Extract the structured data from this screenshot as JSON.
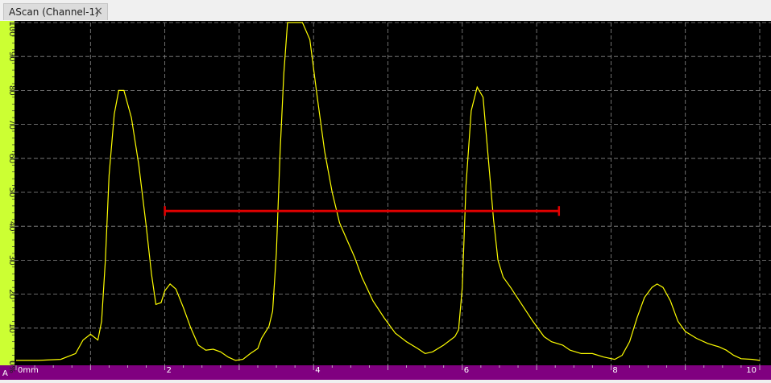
{
  "tab": {
    "title": "AScan (Channel-1)",
    "close_glyph": "×"
  },
  "colors": {
    "background": "#000000",
    "grid": "#8a8a8a",
    "signal": "#ffff00",
    "gate": "#e00000",
    "amplitude_axis": "#ccff33",
    "depth_axis": "#800080",
    "axis_text": "#ffffff"
  },
  "corner_label": "A",
  "chart_data": {
    "type": "line",
    "xlim": [
      0,
      10
    ],
    "ylim": [
      0,
      100
    ],
    "x_unit": "mm",
    "y_unit": "%",
    "x_tick_labels": [
      "0mm",
      "2",
      "4",
      "6",
      "8",
      "10"
    ],
    "y_tick_labels": [
      "0%",
      "10",
      "20",
      "30",
      "40",
      "50",
      "60",
      "70",
      "80",
      "90",
      "100"
    ],
    "grid": true,
    "gate": {
      "start": 2.0,
      "end": 7.3,
      "level": 44.5
    },
    "series": [
      {
        "points": [
          [
            0,
            0.5
          ],
          [
            0.3,
            0.5
          ],
          [
            0.6,
            0.8
          ],
          [
            0.8,
            2.5
          ],
          [
            0.9,
            6.5
          ],
          [
            1.0,
            8.2
          ],
          [
            1.1,
            6.5
          ],
          [
            1.15,
            12
          ],
          [
            1.2,
            30
          ],
          [
            1.25,
            55
          ],
          [
            1.32,
            73
          ],
          [
            1.38,
            80
          ],
          [
            1.45,
            80
          ],
          [
            1.55,
            72
          ],
          [
            1.65,
            58
          ],
          [
            1.75,
            40
          ],
          [
            1.82,
            26
          ],
          [
            1.88,
            17
          ],
          [
            1.95,
            17.5
          ],
          [
            2.0,
            21
          ],
          [
            2.07,
            23
          ],
          [
            2.15,
            21.5
          ],
          [
            2.25,
            16
          ],
          [
            2.35,
            10
          ],
          [
            2.45,
            5
          ],
          [
            2.55,
            3.5
          ],
          [
            2.65,
            3.8
          ],
          [
            2.75,
            3
          ],
          [
            2.85,
            1.5
          ],
          [
            2.95,
            0.5
          ],
          [
            3.05,
            0.8
          ],
          [
            3.15,
            2.5
          ],
          [
            3.25,
            4
          ],
          [
            3.3,
            7
          ],
          [
            3.4,
            10.5
          ],
          [
            3.45,
            15
          ],
          [
            3.5,
            32
          ],
          [
            3.55,
            62
          ],
          [
            3.6,
            85
          ],
          [
            3.65,
            100
          ],
          [
            3.7,
            100
          ],
          [
            3.85,
            100
          ],
          [
            3.95,
            95
          ],
          [
            4.05,
            78
          ],
          [
            4.15,
            62
          ],
          [
            4.25,
            50
          ],
          [
            4.35,
            41
          ],
          [
            4.45,
            36
          ],
          [
            4.55,
            31
          ],
          [
            4.65,
            25
          ],
          [
            4.8,
            18
          ],
          [
            4.95,
            13
          ],
          [
            5.1,
            8.5
          ],
          [
            5.25,
            6
          ],
          [
            5.4,
            4
          ],
          [
            5.5,
            2.5
          ],
          [
            5.6,
            3
          ],
          [
            5.75,
            5
          ],
          [
            5.9,
            7.5
          ],
          [
            5.95,
            9.5
          ],
          [
            6.0,
            22
          ],
          [
            6.05,
            52
          ],
          [
            6.12,
            74
          ],
          [
            6.2,
            81
          ],
          [
            6.28,
            78
          ],
          [
            6.35,
            60
          ],
          [
            6.42,
            42
          ],
          [
            6.48,
            30
          ],
          [
            6.55,
            25
          ],
          [
            6.65,
            22
          ],
          [
            6.8,
            17
          ],
          [
            6.95,
            12
          ],
          [
            7.1,
            7.5
          ],
          [
            7.2,
            6
          ],
          [
            7.35,
            5
          ],
          [
            7.45,
            3.5
          ],
          [
            7.6,
            2.5
          ],
          [
            7.75,
            2.5
          ],
          [
            7.9,
            1.5
          ],
          [
            8.05,
            0.8
          ],
          [
            8.15,
            2
          ],
          [
            8.25,
            6
          ],
          [
            8.35,
            13
          ],
          [
            8.45,
            19
          ],
          [
            8.55,
            22
          ],
          [
            8.62,
            23
          ],
          [
            8.7,
            22
          ],
          [
            8.8,
            18
          ],
          [
            8.9,
            12
          ],
          [
            9.0,
            9
          ],
          [
            9.15,
            7
          ],
          [
            9.3,
            5.5
          ],
          [
            9.45,
            4.5
          ],
          [
            9.55,
            3.5
          ],
          [
            9.65,
            2
          ],
          [
            9.75,
            1
          ],
          [
            9.9,
            0.8
          ],
          [
            10.0,
            0.5
          ]
        ]
      }
    ]
  }
}
